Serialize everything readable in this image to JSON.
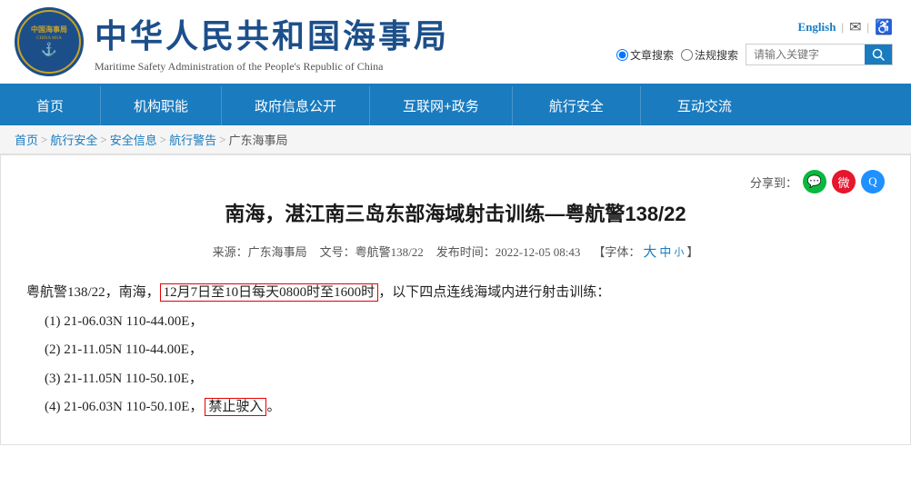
{
  "header": {
    "logo_cn_line1": "中国海事",
    "logo_cn_line2": "局",
    "logo_en": "CHINA MSA",
    "title_cn": "中华人民共和国海事局",
    "title_en": "Maritime Safety Administration of the People's Republic of China",
    "links": {
      "english": "English",
      "separator1": "|",
      "email_icon": "✉",
      "separator2": "|",
      "access_icon": "♿"
    },
    "search": {
      "radio1": "文章搜索",
      "radio2": "法规搜索",
      "placeholder": "请输入关键字",
      "button_icon": "🔍"
    }
  },
  "nav": {
    "items": [
      "首页",
      "机构职能",
      "政府信息公开",
      "互联网+政务",
      "航行安全",
      "互动交流"
    ]
  },
  "breadcrumb": {
    "items": [
      "首页",
      "航行安全",
      "安全信息",
      "航行警告",
      "广东海事局"
    ]
  },
  "article": {
    "share_label": "分享到：",
    "title": "南海，湛江南三岛东部海域射击训练—粤航警138/22",
    "meta": {
      "source_label": "来源：",
      "source": "广东海事局",
      "doc_label": "文号：",
      "doc": "粤航警138/22",
      "date_label": "发布时间：",
      "date": "2022-12-05 08:43",
      "font_label": "【字体：",
      "font_large": "大",
      "font_medium": "中",
      "font_small": "小",
      "font_end": "】"
    },
    "body": {
      "intro": "粤航警138/22，南海，",
      "highlight": "12月7日至10日每天0800时至1600时",
      "intro_cont": "，以下四点连线海域内进行射击训练：",
      "points": [
        "(1)  21-06.03N  110-44.00E，",
        "(2)  21-11.05N  110-44.00E，",
        "(3)  21-11.05N  110-50.10E，",
        "(4)  21-06.03N  110-50.10E，"
      ],
      "forbidden": "禁止驶入",
      "forbidden_suffix": "。"
    }
  }
}
